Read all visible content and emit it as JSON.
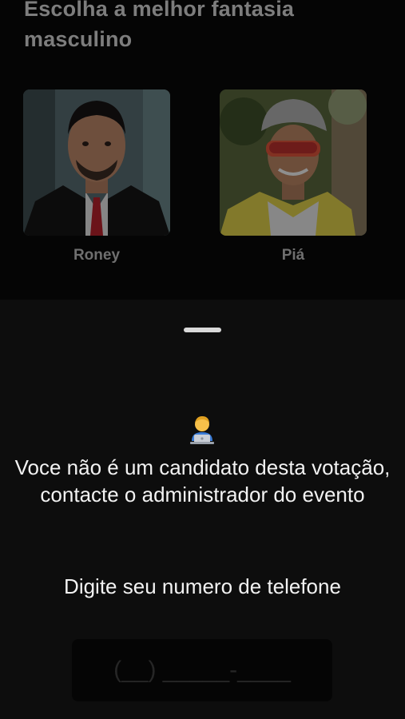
{
  "page": {
    "title": "Escolha a melhor fantasia masculino"
  },
  "candidates": [
    {
      "name": "Roney"
    },
    {
      "name": "Piá"
    }
  ],
  "sheet": {
    "icon": "technologist-emoji-icon",
    "message": "Voce não é um candidato desta votação, contacte o administrador do evento",
    "phone_label": "Digite seu numero de telefone",
    "phone_placeholder": "(__) _____-____"
  }
}
